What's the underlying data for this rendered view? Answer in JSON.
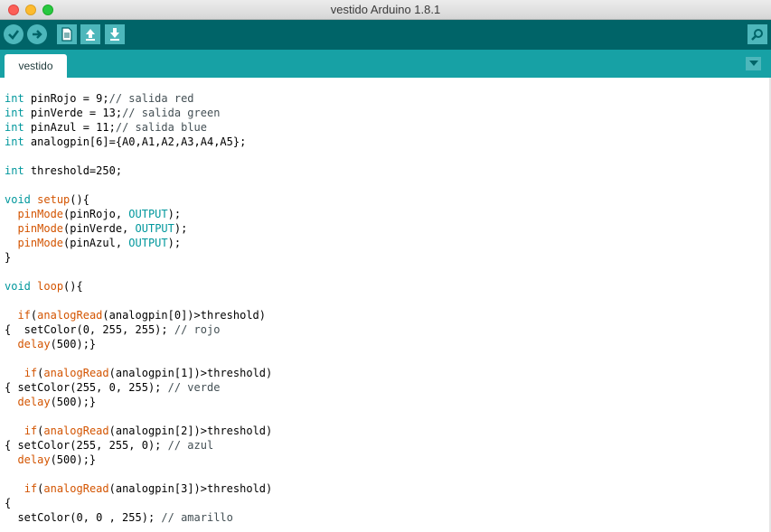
{
  "window": {
    "title": "vestido Arduino 1.8.1"
  },
  "toolbar": {
    "buttons": [
      {
        "name": "verify",
        "icon": "checkmark-icon"
      },
      {
        "name": "upload",
        "icon": "arrow-right-icon"
      },
      {
        "name": "new",
        "icon": "new-document-icon"
      },
      {
        "name": "open",
        "icon": "arrow-up-icon"
      },
      {
        "name": "save",
        "icon": "arrow-down-icon"
      }
    ],
    "serial_monitor_icon": "magnifier-icon"
  },
  "tabs": [
    {
      "label": "vestido"
    }
  ],
  "colors": {
    "toolbar": "#006468",
    "tabbar": "#17a1a5",
    "button": "#4db7bb",
    "type_keyword": "#00979c",
    "function_keyword": "#d35400"
  },
  "editor": {
    "lines": [
      [
        {
          "t": "int",
          "c": "kw-type"
        },
        {
          "t": " pinRojo = 9;"
        },
        {
          "t": "// salida red",
          "c": "cm"
        }
      ],
      [
        {
          "t": "int",
          "c": "kw-type"
        },
        {
          "t": " pinVerde = 13;"
        },
        {
          "t": "// salida green",
          "c": "cm"
        }
      ],
      [
        {
          "t": "int",
          "c": "kw-type"
        },
        {
          "t": " pinAzul = 11;"
        },
        {
          "t": "// salida blue",
          "c": "cm"
        }
      ],
      [
        {
          "t": "int",
          "c": "kw-type"
        },
        {
          "t": " analogpin[6]={A0,A1,A2,A3,A4,A5};"
        }
      ],
      [],
      [
        {
          "t": "int",
          "c": "kw-type"
        },
        {
          "t": " threshold=250;"
        }
      ],
      [],
      [
        {
          "t": "void",
          "c": "kw-type"
        },
        {
          "t": " "
        },
        {
          "t": "setup",
          "c": "kw-fn"
        },
        {
          "t": "(){"
        }
      ],
      [
        {
          "t": "  "
        },
        {
          "t": "pinMode",
          "c": "kw-fn"
        },
        {
          "t": "(pinRojo, "
        },
        {
          "t": "OUTPUT",
          "c": "kw-const"
        },
        {
          "t": ");"
        }
      ],
      [
        {
          "t": "  "
        },
        {
          "t": "pinMode",
          "c": "kw-fn"
        },
        {
          "t": "(pinVerde, "
        },
        {
          "t": "OUTPUT",
          "c": "kw-const"
        },
        {
          "t": ");"
        }
      ],
      [
        {
          "t": "  "
        },
        {
          "t": "pinMode",
          "c": "kw-fn"
        },
        {
          "t": "(pinAzul, "
        },
        {
          "t": "OUTPUT",
          "c": "kw-const"
        },
        {
          "t": ");"
        }
      ],
      [
        {
          "t": "}"
        }
      ],
      [],
      [
        {
          "t": "void",
          "c": "kw-type"
        },
        {
          "t": " "
        },
        {
          "t": "loop",
          "c": "kw-fn"
        },
        {
          "t": "(){"
        }
      ],
      [],
      [
        {
          "t": "  "
        },
        {
          "t": "if",
          "c": "kw-fn"
        },
        {
          "t": "("
        },
        {
          "t": "analogRead",
          "c": "kw-fn"
        },
        {
          "t": "(analogpin[0])>threshold)"
        }
      ],
      [
        {
          "t": "{  setColor(0, 255, 255); "
        },
        {
          "t": "// rojo",
          "c": "cm"
        }
      ],
      [
        {
          "t": "  "
        },
        {
          "t": "delay",
          "c": "kw-fn"
        },
        {
          "t": "(500);}"
        }
      ],
      [],
      [
        {
          "t": "   "
        },
        {
          "t": "if",
          "c": "kw-fn"
        },
        {
          "t": "("
        },
        {
          "t": "analogRead",
          "c": "kw-fn"
        },
        {
          "t": "(analogpin[1])>threshold)"
        }
      ],
      [
        {
          "t": "{ setColor(255, 0, 255); "
        },
        {
          "t": "// verde",
          "c": "cm"
        }
      ],
      [
        {
          "t": "  "
        },
        {
          "t": "delay",
          "c": "kw-fn"
        },
        {
          "t": "(500);}"
        }
      ],
      [],
      [
        {
          "t": "   "
        },
        {
          "t": "if",
          "c": "kw-fn"
        },
        {
          "t": "("
        },
        {
          "t": "analogRead",
          "c": "kw-fn"
        },
        {
          "t": "(analogpin[2])>threshold)"
        }
      ],
      [
        {
          "t": "{ setColor(255, 255, 0); "
        },
        {
          "t": "// azul",
          "c": "cm"
        }
      ],
      [
        {
          "t": "  "
        },
        {
          "t": "delay",
          "c": "kw-fn"
        },
        {
          "t": "(500);}"
        }
      ],
      [],
      [
        {
          "t": "   "
        },
        {
          "t": "if",
          "c": "kw-fn"
        },
        {
          "t": "("
        },
        {
          "t": "analogRead",
          "c": "kw-fn"
        },
        {
          "t": "(analogpin[3])>threshold)"
        }
      ],
      [
        {
          "t": "{"
        }
      ],
      [
        {
          "t": "  setColor(0, 0 , 255); "
        },
        {
          "t": "// amarillo",
          "c": "cm"
        }
      ]
    ]
  }
}
